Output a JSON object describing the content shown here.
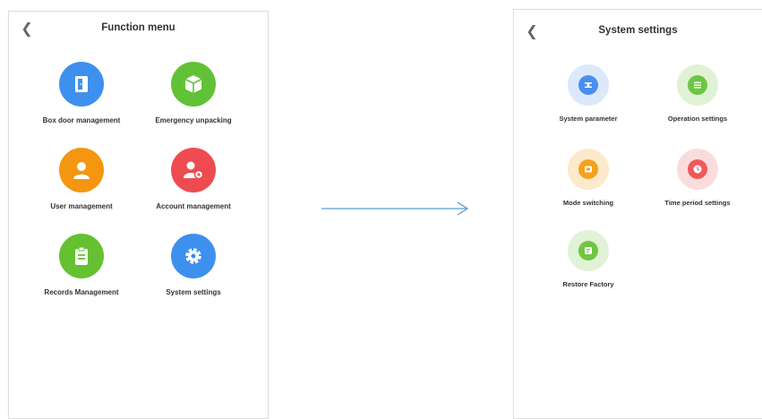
{
  "function_menu": {
    "title": "Function menu",
    "back_icon": "chevron-left-icon",
    "items": [
      {
        "label": "Box door management",
        "icon": "door-icon",
        "color": "#3e90ee"
      },
      {
        "label": "Emergency unpacking",
        "icon": "box-icon",
        "color": "#62c237"
      },
      {
        "label": "User management",
        "icon": "user-icon",
        "color": "#f4960f"
      },
      {
        "label": "Account management",
        "icon": "user-gear-icon",
        "color": "#ee4b50"
      },
      {
        "label": "Records Management",
        "icon": "clipboard-icon",
        "color": "#66c131"
      },
      {
        "label": "System settings",
        "icon": "gear-icon",
        "color": "#3e90ee"
      }
    ]
  },
  "system_settings": {
    "title": "System settings",
    "back_icon": "chevron-left-icon",
    "items": [
      {
        "label": "System parameter",
        "icon": "parameter-icon",
        "color": "#4a8ff0",
        "halo": "#dbe9fb"
      },
      {
        "label": "Operation settings",
        "icon": "list-icon",
        "color": "#6cc644",
        "halo": "#e0f2d6"
      },
      {
        "label": "Mode switching",
        "icon": "mode-icon",
        "color": "#f4a21c",
        "halo": "#fde9cc"
      },
      {
        "label": "Time period settings",
        "icon": "clock-icon",
        "color": "#ee5a5a",
        "halo": "#fbdcdc"
      },
      {
        "label": "Restore Factory",
        "icon": "restore-icon",
        "color": "#72c544",
        "halo": "#e1f2d6"
      }
    ]
  },
  "flow_arrow_color": "#5b9bd5"
}
